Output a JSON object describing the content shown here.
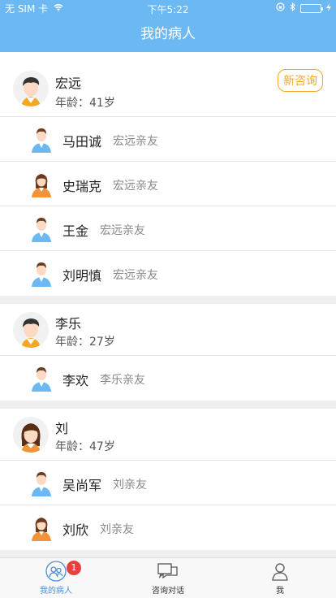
{
  "status_bar": {
    "carrier": "无 SIM 卡",
    "time": "下午5:22"
  },
  "nav": {
    "title": "我的病人"
  },
  "patients": [
    {
      "name": "宏远",
      "age_label": "年龄：41岁",
      "action": "新咨询",
      "gender": "male",
      "relatives": [
        {
          "name": "马田诚",
          "tag": "宏远亲友",
          "gender": "male"
        },
        {
          "name": "史瑞克",
          "tag": "宏远亲友",
          "gender": "female"
        },
        {
          "name": "王金",
          "tag": "宏远亲友",
          "gender": "male"
        },
        {
          "name": "刘明慎",
          "tag": "宏远亲友",
          "gender": "male"
        }
      ]
    },
    {
      "name": "李乐",
      "age_label": "年龄：27岁",
      "gender": "male",
      "relatives": [
        {
          "name": "李欢",
          "tag": "李乐亲友",
          "gender": "male"
        }
      ]
    },
    {
      "name": "刘",
      "age_label": "年龄：47岁",
      "gender": "female",
      "relatives": [
        {
          "name": "吴尚军",
          "tag": "刘亲友",
          "gender": "male"
        },
        {
          "name": "刘欣",
          "tag": "刘亲友",
          "gender": "female"
        }
      ]
    }
  ],
  "tabbar": {
    "tabs": [
      {
        "label": "我的病人",
        "icon": "patients-icon",
        "active": true,
        "badge": "1"
      },
      {
        "label": "咨询对话",
        "icon": "chat-icon",
        "active": false
      },
      {
        "label": "我",
        "icon": "profile-icon",
        "active": false
      }
    ]
  },
  "colors": {
    "nav": "#6cb8f2",
    "accent": "#f5a623",
    "tab_active": "#4a90d9",
    "badge": "#e8403c"
  }
}
